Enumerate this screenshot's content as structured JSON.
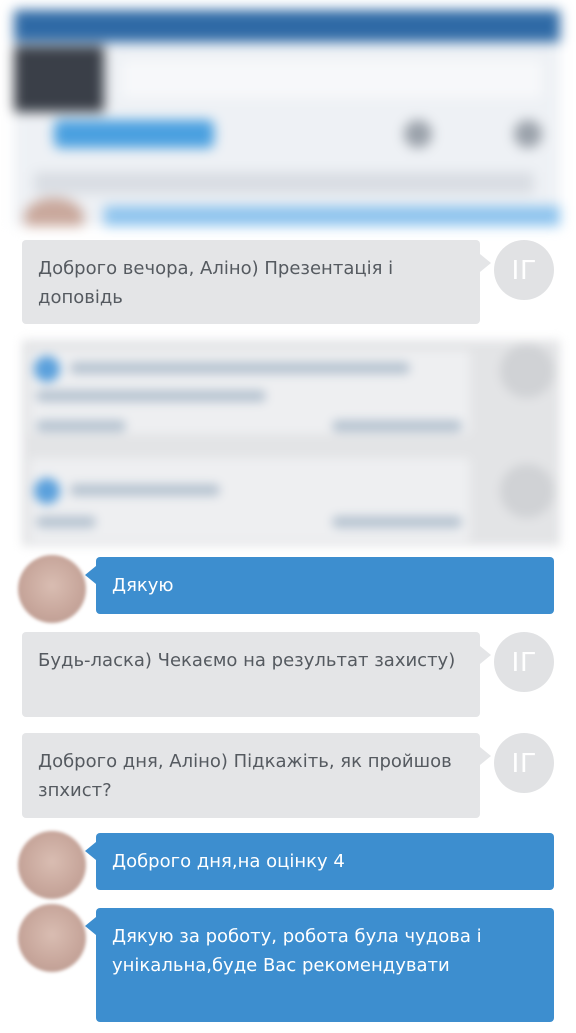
{
  "messages": [
    {
      "id": "m1",
      "direction": "incoming",
      "text": "Доброго вечора, Аліно) Презентація і доповідь",
      "avatar_initials": "ІГ"
    },
    {
      "id": "m2",
      "direction": "outgoing",
      "text": "Дякую"
    },
    {
      "id": "m3",
      "direction": "incoming",
      "text": "Будь-ласка) Чекаємо на результат захисту)",
      "avatar_initials": "ІГ"
    },
    {
      "id": "m4",
      "direction": "incoming",
      "text": "Доброго дня, Аліно) Підкажіть, як пройшов зпхист?",
      "avatar_initials": "ІГ"
    },
    {
      "id": "m5",
      "direction": "outgoing",
      "text": "Доброго дня,на оцінку 4"
    },
    {
      "id": "m6",
      "direction": "outgoing",
      "text": "Дякую за роботу, робота була чудова і унікальна,буде Вас рекомендувати"
    }
  ],
  "colors": {
    "incoming_bubble": "#e4e5e7",
    "outgoing_bubble": "#3d8ecf",
    "initials_avatar": "#e1e2e4"
  }
}
